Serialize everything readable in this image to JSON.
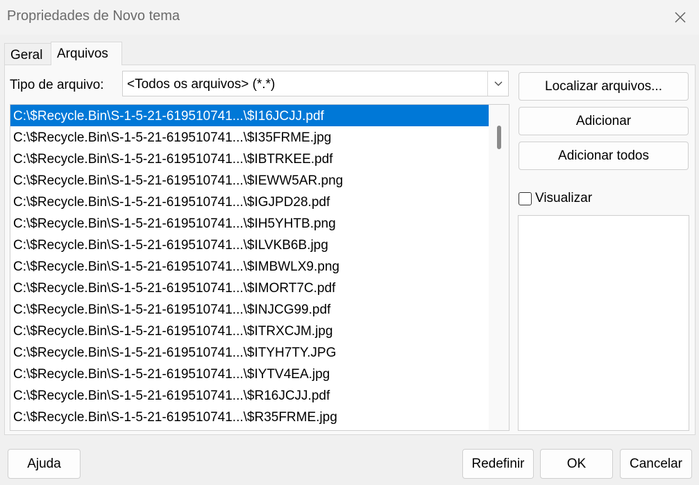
{
  "window": {
    "title": "Propriedades de Novo tema",
    "close_icon": "close-icon"
  },
  "tabs": [
    {
      "label": "Geral",
      "active": false
    },
    {
      "label": "Arquivos",
      "active": true
    }
  ],
  "filetype": {
    "label": "Tipo de arquivo:",
    "value": "<Todos os arquivos> (*.*)",
    "arrow_icon": "chevron-down-icon"
  },
  "files": [
    "C:\\$Recycle.Bin\\S-1-5-21-619510741...\\$I16JCJJ.pdf",
    "C:\\$Recycle.Bin\\S-1-5-21-619510741...\\$I35FRME.jpg",
    "C:\\$Recycle.Bin\\S-1-5-21-619510741...\\$IBTRKEE.pdf",
    "C:\\$Recycle.Bin\\S-1-5-21-619510741...\\$IEWW5AR.png",
    "C:\\$Recycle.Bin\\S-1-5-21-619510741...\\$IGJPD28.pdf",
    "C:\\$Recycle.Bin\\S-1-5-21-619510741...\\$IH5YHTB.png",
    "C:\\$Recycle.Bin\\S-1-5-21-619510741...\\$ILVKB6B.jpg",
    "C:\\$Recycle.Bin\\S-1-5-21-619510741...\\$IMBWLX9.png",
    "C:\\$Recycle.Bin\\S-1-5-21-619510741...\\$IMORT7C.pdf",
    "C:\\$Recycle.Bin\\S-1-5-21-619510741...\\$INJCG99.pdf",
    "C:\\$Recycle.Bin\\S-1-5-21-619510741...\\$ITRXCJM.jpg",
    "C:\\$Recycle.Bin\\S-1-5-21-619510741...\\$ITYH7TY.JPG",
    "C:\\$Recycle.Bin\\S-1-5-21-619510741...\\$IYTV4EA.jpg",
    "C:\\$Recycle.Bin\\S-1-5-21-619510741...\\$R16JCJJ.pdf",
    "C:\\$Recycle.Bin\\S-1-5-21-619510741...\\$R35FRME.jpg"
  ],
  "selected_index": 0,
  "actions": {
    "locate": "Localizar arquivos...",
    "add": "Adicionar",
    "add_all": "Adicionar todos"
  },
  "preview": {
    "label": "Visualizar",
    "checked": false
  },
  "footer": {
    "help": "Ajuda",
    "reset": "Redefinir",
    "ok": "OK",
    "cancel": "Cancelar"
  },
  "colors": {
    "selection": "#0078d7",
    "dialog_bg": "#f0f0f0"
  }
}
